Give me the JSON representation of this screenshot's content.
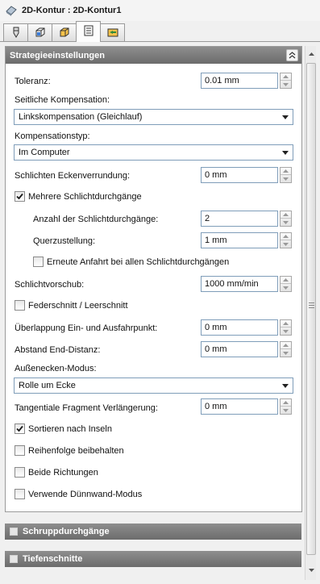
{
  "window": {
    "title": "2D-Kontur : 2D-Kontur1"
  },
  "tabs": [
    {
      "icon": "tool-icon"
    },
    {
      "icon": "stock-box-icon"
    },
    {
      "icon": "geometry-box-icon"
    },
    {
      "icon": "strategy-list-icon",
      "active": true
    },
    {
      "icon": "links-icon"
    }
  ],
  "strategy": {
    "header": "Strategieeinstellungen",
    "toleranz_label": "Toleranz:",
    "toleranz_value": "0.01 mm",
    "seitliche_label": "Seitliche Kompensation:",
    "seitliche_value": "Linkskompensation (Gleichlauf)",
    "komptyp_label": "Kompensationstyp:",
    "komptyp_value": "Im Computer",
    "ecken_label": "Schlichten Eckenverrundung:",
    "ecken_value": "0 mm",
    "mehrere_label": "Mehrere Schlichtdurchgänge",
    "mehrere_checked": true,
    "anzahl_label": "Anzahl der Schlichtdurchgänge:",
    "anzahl_value": "2",
    "quer_label": "Querzustellung:",
    "quer_value": "1 mm",
    "erneute_label": "Erneute Anfahrt bei allen Schlichtdurchgängen",
    "erneute_checked": false,
    "vorschub_label": "Schlichtvorschub:",
    "vorschub_value": "1000 mm/min",
    "feder_label": "Federschnitt / Leerschnitt",
    "feder_checked": false,
    "ueberlapp_label": "Überlappung Ein- und Ausfahrpunkt:",
    "ueberlapp_value": "0 mm",
    "abstand_label": "Abstand End-Distanz:",
    "abstand_value": "0 mm",
    "aussen_label": "Außenecken-Modus:",
    "aussen_value": "Rolle um Ecke",
    "tangential_label": "Tangentiale Fragment Verlängerung:",
    "tangential_value": "0 mm",
    "sortieren_label": "Sortieren nach Inseln",
    "sortieren_checked": true,
    "reihenfolge_label": "Reihenfolge beibehalten",
    "reihenfolge_checked": false,
    "beide_label": "Beide Richtungen",
    "beide_checked": false,
    "duennwand_label": "Verwende Dünnwand-Modus",
    "duennwand_checked": false
  },
  "collapsed_sections": {
    "schrupp": "Schruppdurchgänge",
    "tiefen": "Tiefenschnitte"
  },
  "colors": {
    "header_bg": "#7d7d7d",
    "field_border": "#7f9db9",
    "panel_bg": "#ffffff",
    "app_bg": "#f0f0f0"
  }
}
